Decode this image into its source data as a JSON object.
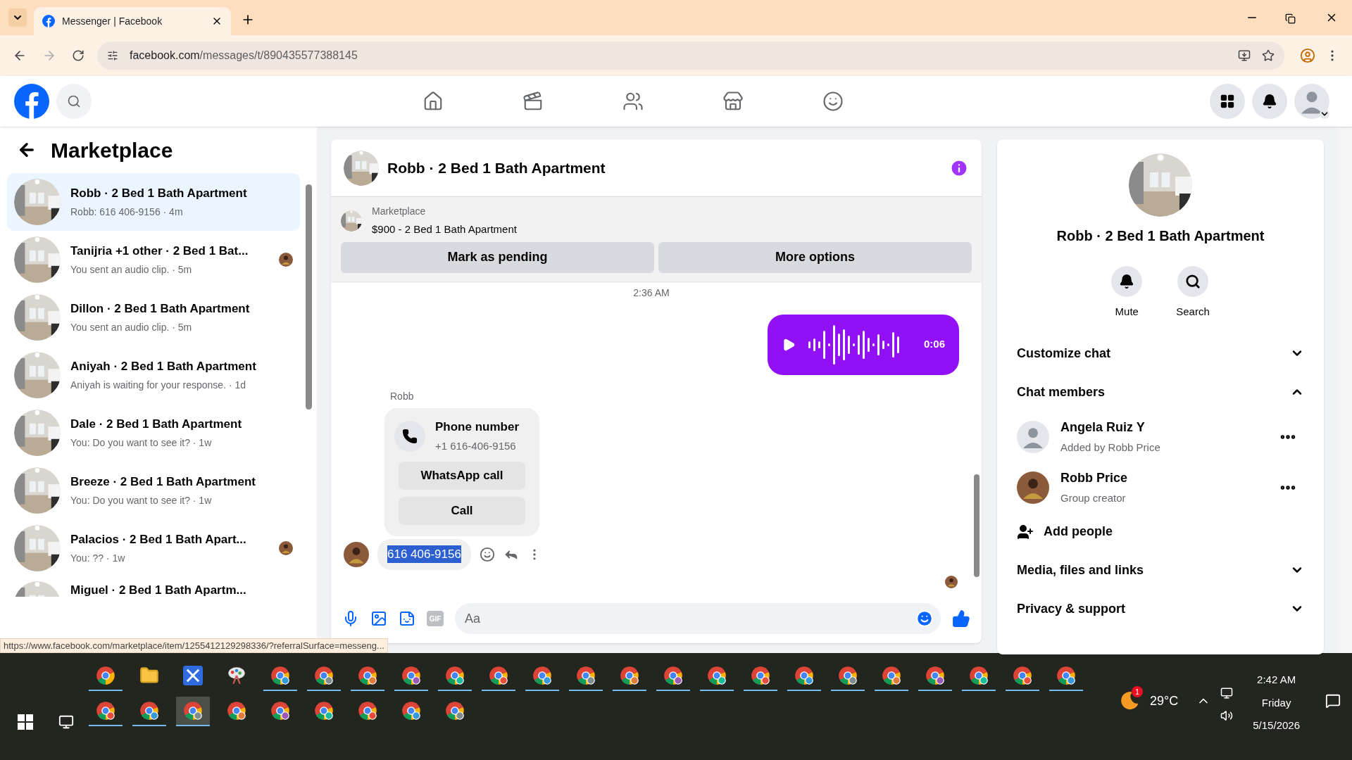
{
  "browser": {
    "tab_title": "Messenger | Facebook",
    "url_host": "facebook.com",
    "url_path": "/messages/t/890435577388145",
    "status_url": "https://www.facebook.com/marketplace/item/1255412129298336/?referralSurface=messeng..."
  },
  "sidebar": {
    "title": "Marketplace",
    "conversations": [
      {
        "title": "Robb · 2 Bed 1 Bath Apartment",
        "preview": "Robb: 616 406-9156 · 4m",
        "selected": true,
        "seen_avatar": false
      },
      {
        "title": "Tanijria +1 other · 2 Bed 1 Bat...",
        "preview": "You sent an audio clip. · 5m",
        "selected": false,
        "seen_avatar": true
      },
      {
        "title": "Dillon · 2 Bed 1 Bath Apartment",
        "preview": "You sent an audio clip. · 5m",
        "selected": false,
        "seen_avatar": false
      },
      {
        "title": "Aniyah · 2 Bed 1 Bath Apartment",
        "preview": "Aniyah is waiting for your response. · 1d",
        "selected": false,
        "seen_avatar": false
      },
      {
        "title": "Dale · 2 Bed 1 Bath Apartment",
        "preview": "You: Do you want to see it? · 1w",
        "selected": false,
        "seen_avatar": false
      },
      {
        "title": "Breeze · 2 Bed 1 Bath Apartment",
        "preview": "You: Do you want to see it? · 1w",
        "selected": false,
        "seen_avatar": false
      },
      {
        "title": "Palacios · 2 Bed 1 Bath Apart...",
        "preview": "You: ?? · 1w",
        "selected": false,
        "seen_avatar": true
      },
      {
        "title": "Miguel · 2 Bed 1 Bath Apartm...",
        "selected": false,
        "seen_avatar": false
      }
    ]
  },
  "chat": {
    "title": "Robb · 2 Bed 1 Bath Apartment",
    "listing": {
      "label": "Marketplace",
      "name": "$900 - 2 Bed 1 Bath Apartment"
    },
    "actions": [
      "Mark as pending",
      "More options"
    ],
    "timestamp": "2:36 AM",
    "audio": {
      "duration": "0:06"
    },
    "sender": "Robb",
    "phone_card": {
      "title": "Phone number",
      "number": "+1 616-406-9156",
      "buttons": [
        "WhatsApp call",
        "Call"
      ]
    },
    "message": {
      "text": "616 406-9156",
      "highlighted": true
    },
    "composer": {
      "gif_label": "GIF",
      "placeholder": "Aa"
    }
  },
  "details": {
    "title": "Robb · 2 Bed 1 Bath Apartment",
    "actions": [
      {
        "kind": "bell",
        "label": "Mute"
      },
      {
        "kind": "search",
        "label": "Search"
      }
    ],
    "sections": [
      {
        "label": "Customize chat",
        "expanded": false
      },
      {
        "label": "Chat members",
        "expanded": true,
        "members": [
          {
            "name": "Angela Ruiz Y",
            "role": "Added by Robb Price",
            "kind": "silhouette"
          },
          {
            "name": "Robb Price",
            "role": "Group creator"
          }
        ],
        "add_label": "Add people"
      },
      {
        "label": "Media, files and links",
        "expanded": false
      },
      {
        "label": "Privacy & support",
        "expanded": false
      }
    ]
  },
  "taskbar": {
    "row_1": [
      {
        "kind": "browser",
        "running": true
      },
      {
        "kind": "folder",
        "running": false
      },
      {
        "kind": "app",
        "running": false
      },
      {
        "kind": "paint",
        "running": false
      },
      {
        "kind": "browser",
        "running": true
      },
      {
        "kind": "browser",
        "running": true
      },
      {
        "kind": "browser",
        "running": true
      },
      {
        "kind": "browser",
        "running": true
      },
      {
        "kind": "browser",
        "running": true
      },
      {
        "kind": "browser",
        "running": true
      },
      {
        "kind": "browser",
        "running": true
      },
      {
        "kind": "browser",
        "running": true
      },
      {
        "kind": "browser",
        "running": true
      },
      {
        "kind": "browser",
        "running": true
      },
      {
        "kind": "browser",
        "running": true
      },
      {
        "kind": "browser",
        "running": true
      },
      {
        "kind": "browser",
        "running": true
      },
      {
        "kind": "browser",
        "running": true
      },
      {
        "kind": "browser",
        "running": true
      },
      {
        "kind": "browser",
        "running": true
      },
      {
        "kind": "browser",
        "running": true
      },
      {
        "kind": "browser",
        "running": true
      },
      {
        "kind": "browser",
        "running": true
      }
    ],
    "row_2": [
      {
        "kind": "browser",
        "running": true
      },
      {
        "kind": "browser",
        "running": true
      },
      {
        "kind": "browser",
        "running": true,
        "selected": true
      },
      {
        "kind": "browser",
        "running": false
      },
      {
        "kind": "browser",
        "running": false
      },
      {
        "kind": "browser",
        "running": false
      },
      {
        "kind": "browser",
        "running": false
      },
      {
        "kind": "browser",
        "running": false
      },
      {
        "kind": "browser",
        "running": false
      }
    ],
    "weather_badge": "1",
    "temperature": "29°C",
    "time": "2:42 AM",
    "day": "Friday",
    "date": "5/15/2026"
  }
}
